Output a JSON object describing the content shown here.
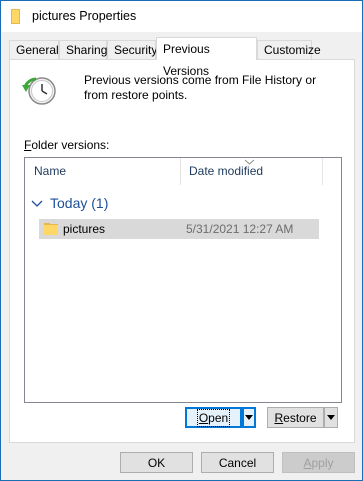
{
  "window": {
    "title": "pictures Properties"
  },
  "tabs": [
    {
      "label": "General"
    },
    {
      "label": "Sharing"
    },
    {
      "label": "Security"
    },
    {
      "label": "Previous Versions",
      "active": true
    },
    {
      "label": "Customize"
    }
  ],
  "intro": {
    "text": "Previous versions come from File History or from restore points."
  },
  "folder_versions": {
    "label_rest": "older versions:",
    "label_accel": "F",
    "columns": [
      {
        "label": "Name"
      },
      {
        "label": "Date modified"
      }
    ],
    "groups": [
      {
        "label": "Today (1)",
        "items": [
          {
            "name": "pictures",
            "date_modified": "5/31/2021 12:27 AM"
          }
        ]
      }
    ]
  },
  "buttons": {
    "open_accel": "O",
    "open_rest": "pen",
    "restore_accel": "R",
    "restore_rest": "estore",
    "ok": "OK",
    "cancel": "Cancel",
    "apply_accel": "A",
    "apply_rest": "pply"
  },
  "colors": {
    "accent": "#0078d7",
    "group_text": "#1e4e9a",
    "selection": "#d9d9d9",
    "folder": "#ffd766"
  }
}
